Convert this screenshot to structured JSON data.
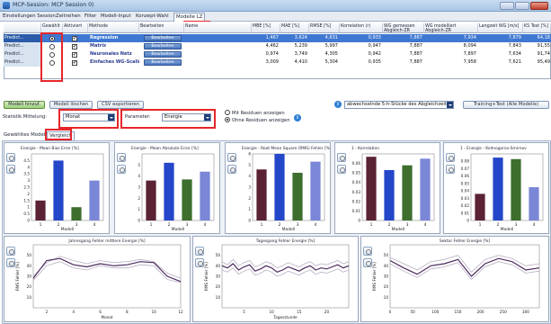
{
  "window": {
    "title": "MCP-Session: MCP Session 0)"
  },
  "menu": {
    "tabs": [
      "Einstellungen Session",
      "Zeitreihen",
      "Filter",
      "Modell-Input",
      "Konzept-Wahl",
      "Modelle LZ"
    ]
  },
  "grid": {
    "headers": [
      "",
      "Gewählt",
      "Aktiviert",
      "Methode",
      "Bearbeiten",
      "Name",
      "MBE [%]",
      "MAE [%]",
      "RMSE [%]",
      "Korrelation (r)",
      "WG gemessen Abgleich-ZR",
      "WG modelliert Abgleich-ZR",
      "Langzeit WG [m/s]",
      "KS Test [%]"
    ],
    "edit_label": "Bearbeiten",
    "rows": [
      {
        "pred": "Predict...",
        "chosen": true,
        "active": true,
        "method": "Regression",
        "name": "",
        "mbe": "1,467",
        "mae": "3,624",
        "rmse": "4,631",
        "corr": "0,933",
        "wg_meas": "7,887",
        "wg_mod": "7,934",
        "lt": "7,879",
        "ks": "64,18",
        "selected": true
      },
      {
        "pred": "Predict...",
        "chosen": false,
        "active": true,
        "method": "Matrix",
        "name": "",
        "mbe": "4,462",
        "mae": "5,239",
        "rmse": "5,997",
        "corr": "0,947",
        "wg_meas": "7,887",
        "wg_mod": "8,094",
        "lt": "7,843",
        "ks": "91,55",
        "selected": false
      },
      {
        "pred": "Predict...",
        "chosen": false,
        "active": true,
        "method": "Neuronales Netz",
        "name": "",
        "mbe": "0,974",
        "mae": "3,749",
        "rmse": "4,305",
        "corr": "0,942",
        "wg_meas": "7,887",
        "wg_mod": "7,897",
        "lt": "7,634",
        "ks": "91,74",
        "selected": false
      },
      {
        "pred": "Predict...",
        "chosen": false,
        "active": true,
        "method": "Einfaches WG-Scaling",
        "name": "",
        "mbe": "3,009",
        "mae": "4,410",
        "rmse": "5,304",
        "corr": "0,935",
        "wg_meas": "7,887",
        "wg_mod": "7,958",
        "lt": "7,621",
        "ks": "95,49"
      }
    ]
  },
  "controls": {
    "add_model": "Modell hinzuf.",
    "delete_model": "Modell löschen",
    "export_csv": "CSV exportieren",
    "stat_label": "Statistik Mittelung:",
    "stat_value": "Monat",
    "param_label": "Parameter:",
    "param_value": "Energie",
    "radio_with": "Mit Residuen anzeigen",
    "radio_without": "Ohne Residuen anzeigen",
    "piece_select": "abwechselnde 5-h-Stücke des Abgleichzeitr.",
    "train_test": "Training+Test (Alle Modelle)"
  },
  "subtabs": [
    "Gewähltes Modell",
    "Vergleich"
  ],
  "colors": {
    "bar1": "#5a2232",
    "bar2": "#2446c8",
    "bar3": "#3d6e2e",
    "bar4": "#7a86d6",
    "line_dark": "#4a2a5c",
    "line_light": "#b8b0c4",
    "accent_red": "#e6262b"
  },
  "chart_data": [
    {
      "type": "bar",
      "title": "Energie - Mean Bias Error [%]",
      "xlabel": "Modell",
      "categories": [
        "1",
        "2",
        "3",
        "4"
      ],
      "values": [
        1.5,
        4.5,
        1.0,
        3.0
      ],
      "ylim": [
        0,
        5
      ],
      "yticks": [
        "0",
        "0.5",
        "1",
        "1.5",
        "2",
        "2.5",
        "3",
        "3.5",
        "4",
        "4.5"
      ]
    },
    {
      "type": "bar",
      "title": "Energie - Mean Absolute Error [%]",
      "xlabel": "Modell",
      "categories": [
        "1",
        "2",
        "3",
        "4"
      ],
      "values": [
        3.6,
        5.2,
        3.7,
        4.4
      ],
      "ylim": [
        0,
        6
      ],
      "yticks": [
        "0",
        "1",
        "2",
        "3",
        "4",
        "5"
      ]
    },
    {
      "type": "bar",
      "title": "Energie - Root Mean Square (RMS) Fehler [%]",
      "xlabel": "Modell",
      "categories": [
        "1",
        "2",
        "3",
        "4"
      ],
      "values": [
        4.6,
        6.0,
        4.3,
        5.3
      ],
      "ylim": [
        0,
        6
      ],
      "yticks": [
        "0",
        "1",
        "2",
        "3",
        "4",
        "5",
        "6"
      ]
    },
    {
      "type": "bar",
      "title": "1 - Korrelation",
      "xlabel": "Modell",
      "categories": [
        "1",
        "2",
        "3",
        "4"
      ],
      "values": [
        0.067,
        0.053,
        0.058,
        0.065
      ],
      "ylim": [
        0,
        0.07
      ],
      "yticks": [
        "0",
        "0.01",
        "0.02",
        "0.03",
        "0.04",
        "0.05",
        "0.06"
      ]
    },
    {
      "type": "bar",
      "title": "1 - Energie - Kolmogorov-Smirnov",
      "xlabel": "Modell",
      "categories": [
        "1",
        "2",
        "3",
        "4"
      ],
      "values": [
        0.036,
        0.085,
        0.083,
        0.045
      ],
      "ylim": [
        0,
        0.09
      ],
      "yticks": [
        "0",
        "0.01",
        "0.02",
        "0.03",
        "0.04",
        "0.05",
        "0.06",
        "0.07",
        "0.08"
      ]
    },
    {
      "type": "line",
      "title": "Jahresgang Fehler mittlere Energie [%]",
      "xlabel": "Monat",
      "ylabel": "RMS Fehler [%]",
      "x": [
        1,
        2,
        3,
        4,
        5,
        6,
        7,
        8,
        9,
        10,
        11,
        12
      ],
      "xticks": [
        "2",
        "4",
        "6",
        "8",
        "10",
        "12"
      ],
      "ylim": [
        0,
        60
      ],
      "yticks": [
        "10",
        "20",
        "30",
        "40",
        "50"
      ],
      "series": [
        {
          "values": [
            28,
            45,
            47,
            41,
            39,
            42,
            40,
            41,
            44,
            43,
            30,
            25
          ]
        },
        {
          "values": [
            30,
            43,
            49,
            45,
            42,
            45,
            43,
            44,
            46,
            44,
            33,
            28
          ]
        },
        {
          "values": [
            26,
            40,
            44,
            38,
            36,
            40,
            38,
            38,
            41,
            40,
            27,
            24
          ]
        }
      ]
    },
    {
      "type": "line",
      "title": "Tagesgang Fehler Energie [%]",
      "xlabel": "Tagesstunde",
      "ylabel": "RMS Fehler [%]",
      "x": [
        1,
        2,
        3,
        4,
        5,
        6,
        7,
        8,
        9,
        10,
        11,
        12,
        13,
        14,
        15,
        16,
        17,
        18,
        19,
        20,
        21,
        22,
        23,
        24
      ],
      "xticks": [
        "5",
        "10",
        "15",
        "20"
      ],
      "ylim": [
        0,
        60
      ],
      "yticks": [
        "10",
        "20",
        "30",
        "40",
        "50"
      ],
      "series": [
        {
          "values": [
            40,
            38,
            42,
            36,
            39,
            41,
            35,
            37,
            40,
            38,
            34,
            36,
            39,
            37,
            35,
            38,
            40,
            36,
            38,
            37,
            39,
            41,
            38,
            40
          ]
        },
        {
          "values": [
            44,
            41,
            46,
            40,
            43,
            45,
            39,
            41,
            44,
            42,
            38,
            40,
            43,
            41,
            39,
            42,
            44,
            40,
            42,
            41,
            43,
            45,
            42,
            44
          ]
        },
        {
          "values": [
            36,
            34,
            38,
            32,
            35,
            37,
            31,
            33,
            36,
            34,
            30,
            32,
            35,
            33,
            31,
            34,
            36,
            32,
            34,
            33,
            35,
            37,
            34,
            36
          ]
        }
      ]
    },
    {
      "type": "line",
      "title": "Sektor Fehler Energie [%]",
      "xlabel": "",
      "ylabel": "RMS Fehler [%]",
      "x": [
        0,
        30,
        60,
        90,
        120,
        150,
        180,
        210,
        240,
        270,
        300,
        330
      ],
      "xticks": [
        "0",
        "50",
        "100",
        "150",
        "200",
        "250",
        "300"
      ],
      "ylim": [
        0,
        60
      ],
      "yticks": [
        "10",
        "20",
        "30",
        "40",
        "50"
      ],
      "series": [
        {
          "values": [
            45,
            38,
            32,
            40,
            42,
            46,
            30,
            42,
            47,
            44,
            36,
            38
          ]
        },
        {
          "values": [
            48,
            42,
            36,
            44,
            46,
            50,
            34,
            46,
            50,
            47,
            40,
            42
          ]
        },
        {
          "values": [
            42,
            35,
            29,
            37,
            39,
            43,
            27,
            39,
            44,
            41,
            33,
            35
          ]
        }
      ]
    }
  ]
}
